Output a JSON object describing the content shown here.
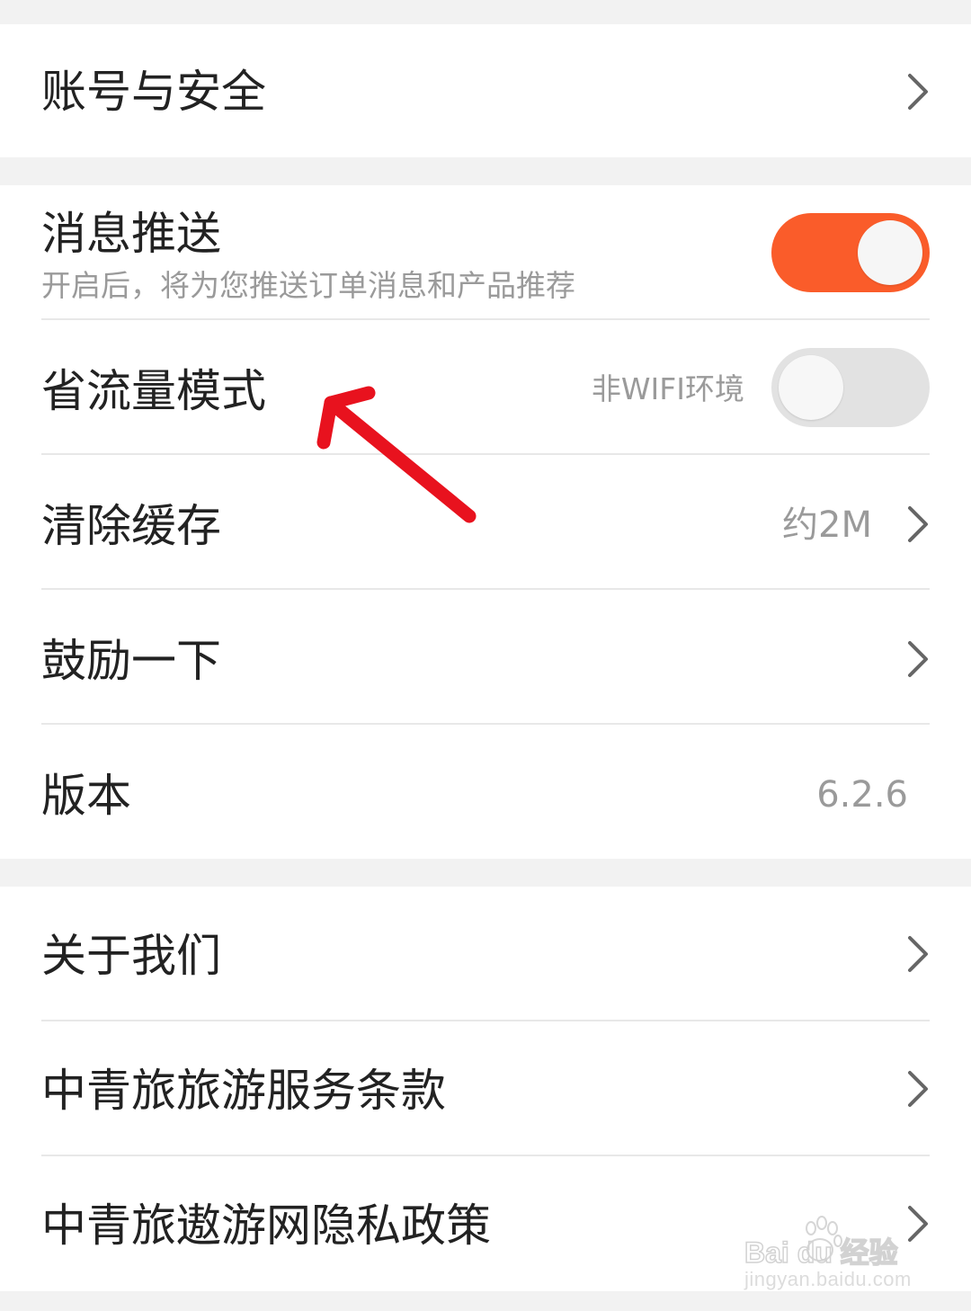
{
  "groups": [
    {
      "rows": [
        {
          "title": "账号与安全",
          "action": "chevron"
        }
      ]
    },
    {
      "rows": [
        {
          "title": "消息推送",
          "subtitle": "开启后，将为您推送订单消息和产品推荐",
          "toggle": "on"
        },
        {
          "title": "省流量模式",
          "value": "非WIFI环境",
          "toggle": "off"
        },
        {
          "title": "清除缓存",
          "value": "约2M",
          "action": "chevron"
        },
        {
          "title": "鼓励一下",
          "action": "chevron"
        },
        {
          "title": "版本",
          "value": "6.2.6"
        }
      ]
    },
    {
      "rows": [
        {
          "title": "关于我们",
          "action": "chevron"
        },
        {
          "title": "中青旅旅游服务条款",
          "action": "chevron"
        },
        {
          "title": "中青旅遨游网隐私政策",
          "action": "chevron"
        }
      ]
    }
  ],
  "annotation": {
    "type": "red-arrow",
    "color": "#e8121e"
  },
  "watermark": {
    "logo_text": "Bai du 经验",
    "url": "jingyan.baidu.com"
  },
  "colors": {
    "accent": "#fa5c2a",
    "toggle_off": "#e2e2e2",
    "background": "#f2f2f2"
  },
  "icons": {
    "chevron": "chevron-right-icon",
    "paw": "paw-icon"
  }
}
